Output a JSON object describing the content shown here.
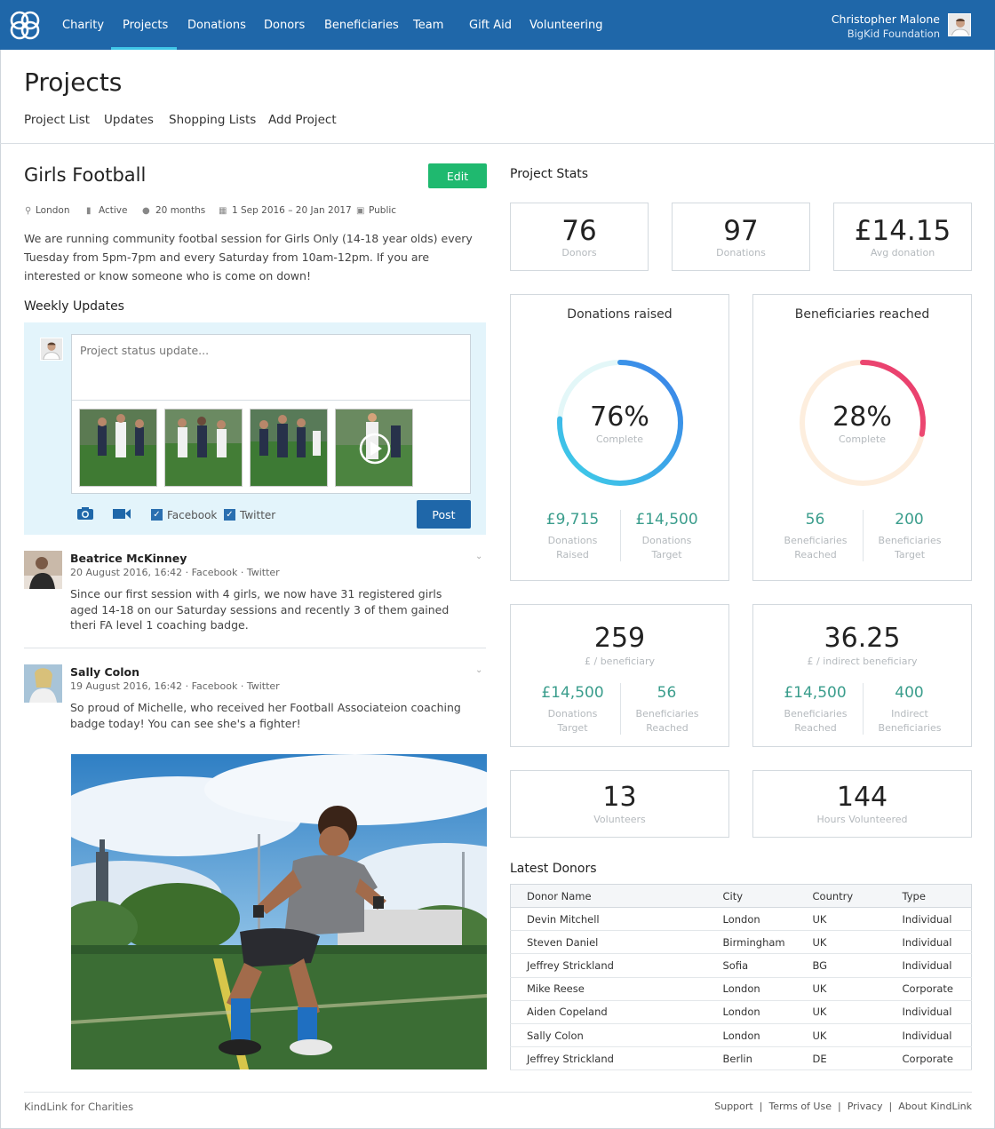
{
  "nav": {
    "items": [
      "Charity",
      "Projects",
      "Donations",
      "Donors",
      "Beneficiaries",
      "Team",
      "Gift Aid",
      "Volunteering"
    ],
    "active": "Projects",
    "user_name": "Christopher Malone",
    "user_org": "BigKid Foundation"
  },
  "page": {
    "title": "Projects",
    "subnav": [
      "Project List",
      "Updates",
      "Shopping Lists",
      "Add Project"
    ]
  },
  "project": {
    "name": "Girls Football",
    "edit_label": "Edit",
    "meta": {
      "location": "London",
      "status": "Active",
      "duration": "20 months",
      "dates": "1 Sep 2016 – 20 Jan 2017",
      "visibility": "Public"
    },
    "description": "We are running community footbal session for Girls Only (14-18 year olds) every Tuesday from 5pm-7pm and every Saturday from 10am-12pm. If you are interested or know someone who is come on down!"
  },
  "updates": {
    "heading": "Weekly Updates",
    "placeholder": "Project status update...",
    "facebook_label": "Facebook",
    "twitter_label": "Twitter",
    "post_label": "Post",
    "posts": [
      {
        "author": "Beatrice McKinney",
        "meta": "20 August 2016, 16:42 · Facebook · Twitter",
        "text": "Since our first session with 4 girls, we now have 31 registered girls aged 14-18 on our Saturday sessions and recently 3 of them gained theri FA level 1 coaching badge."
      },
      {
        "author": "Sally Colon",
        "meta": "19 August 2016, 16:42 · Facebook · Twitter",
        "text": "So proud of Michelle, who received her Football Associateion coaching badge today! You can see she's a fighter!"
      }
    ]
  },
  "stats": {
    "heading": "Project Stats",
    "donors": {
      "value": "76",
      "label": "Donors"
    },
    "donations": {
      "value": "97",
      "label": "Donations"
    },
    "avg": {
      "value": "£14.15",
      "label": "Avg donation"
    },
    "donations_raised": {
      "title": "Donations raised",
      "percent": "76%",
      "complete_label": "Complete",
      "progress": 0.76,
      "left_value": "£9,715",
      "left_label": "Donations Raised",
      "right_value": "£14,500",
      "right_label": "Donations Target"
    },
    "beneficiaries_reached": {
      "title": "Beneficiaries reached",
      "percent": "28%",
      "complete_label": "Complete",
      "progress": 0.28,
      "left_value": "56",
      "left_label": "Beneficiaries Reached",
      "right_value": "200",
      "right_label": "Beneficiaries Target"
    },
    "per_beneficiary": {
      "value": "259",
      "label": "£ / beneficiary",
      "left_value": "£14,500",
      "left_label": "Donations Target",
      "right_value": "56",
      "right_label": "Beneficiaries Reached"
    },
    "per_indirect": {
      "value": "36.25",
      "label": "£ / indirect beneficiary",
      "left_value": "£14,500",
      "left_label": "Beneficiaries Reached",
      "right_value": "400",
      "right_label": "Indirect Beneficiaries"
    },
    "volunteers": {
      "value": "13",
      "label": "Volunteers"
    },
    "hours": {
      "value": "144",
      "label": "Hours Volunteered"
    }
  },
  "donors_table": {
    "heading": "Latest Donors",
    "columns": [
      "Donor Name",
      "City",
      "Country",
      "Type"
    ],
    "rows": [
      [
        "Devin Mitchell",
        "London",
        "UK",
        "Individual"
      ],
      [
        "Steven Daniel",
        "Birmingham",
        "UK",
        "Individual"
      ],
      [
        "Jeffrey Strickland",
        "Sofia",
        "BG",
        "Individual"
      ],
      [
        "Mike Reese",
        "London",
        "UK",
        "Corporate"
      ],
      [
        "Aiden Copeland",
        "London",
        "UK",
        "Individual"
      ],
      [
        "Sally Colon",
        "London",
        "UK",
        "Individual"
      ],
      [
        "Jeffrey Strickland",
        "Berlin",
        "DE",
        "Corporate"
      ]
    ]
  },
  "footer": {
    "left": "KindLink for Charities",
    "links": [
      "Support",
      "Terms of Use",
      "Privacy",
      "About KindLink"
    ]
  },
  "colors": {
    "nav_bg": "#1f67a9",
    "accent": "#3fc6e8",
    "edit_green": "#1fb96f",
    "teal_value": "#3a9d8c",
    "donations_ring": "#3a8fe8",
    "beneficiaries_ring": "#ee4a6e"
  }
}
